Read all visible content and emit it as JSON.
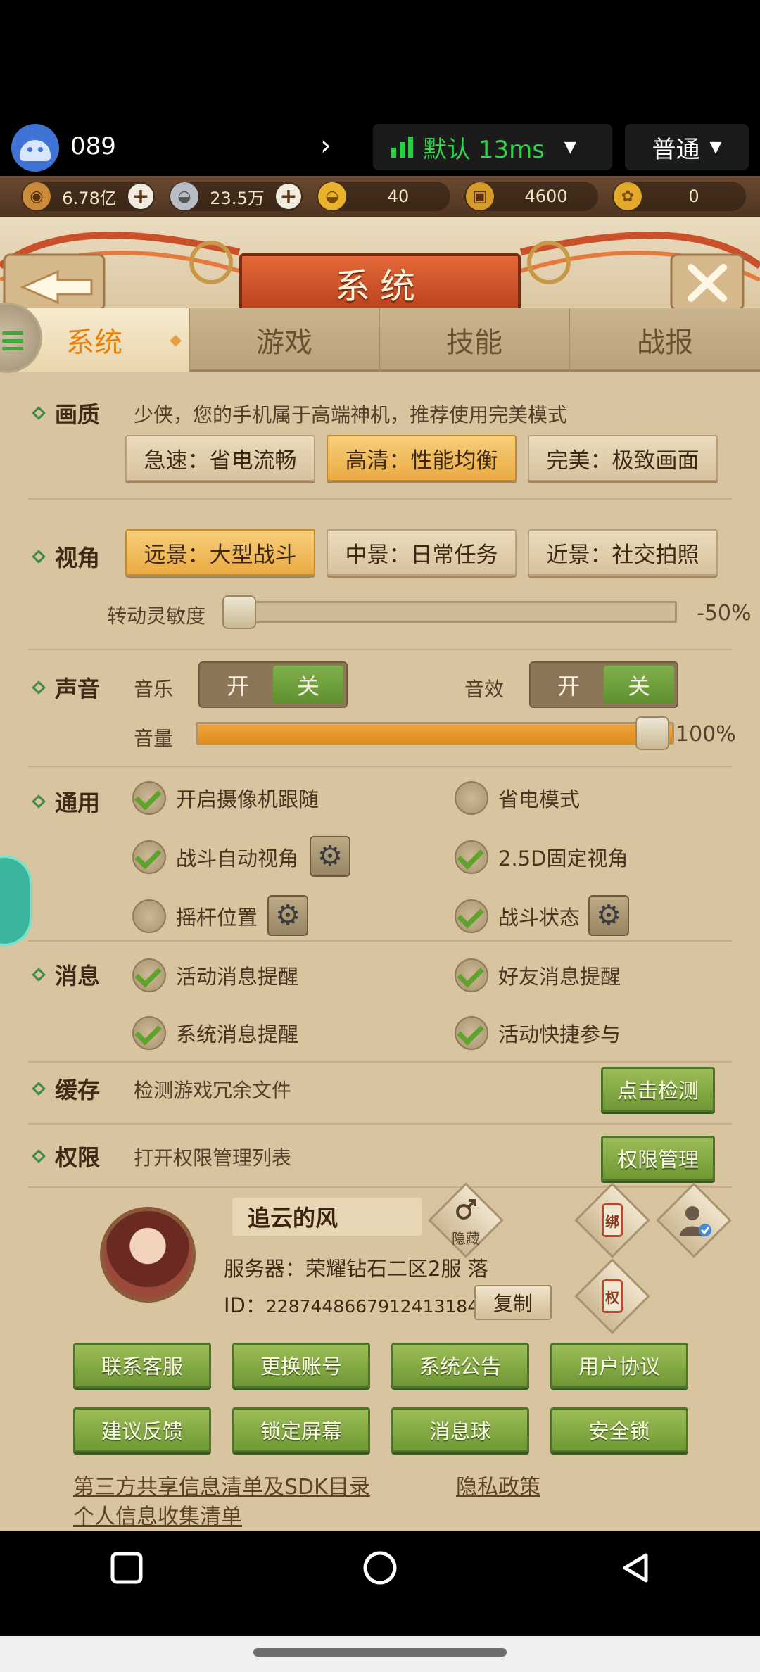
{
  "emulator": {
    "app_name": "089",
    "network": {
      "label": "默认 13ms",
      "color": "#34d14d"
    },
    "mode": {
      "label": "普通"
    }
  },
  "currency": [
    {
      "icon": "coin-icon",
      "value": "6.78亿",
      "has_plus": true
    },
    {
      "icon": "silver-ingot-icon",
      "value": "23.5万",
      "has_plus": true
    },
    {
      "icon": "gold-ingot-icon",
      "value": "40",
      "has_plus": false
    },
    {
      "icon": "gold-chest-icon",
      "value": "4600",
      "has_plus": false
    },
    {
      "icon": "gold-medal-icon",
      "value": "0",
      "has_plus": false
    }
  ],
  "window": {
    "title": "系统"
  },
  "tabs": [
    {
      "label": "系统",
      "active": true
    },
    {
      "label": "游戏",
      "active": false
    },
    {
      "label": "技能",
      "active": false
    },
    {
      "label": "战报",
      "active": false
    }
  ],
  "quality": {
    "label": "画质",
    "description": "少侠，您的手机属于高端神机，推荐使用完美模式",
    "options": [
      "急速：省电流畅",
      "高清：性能均衡",
      "完美：极致画面"
    ],
    "selected_index": 1
  },
  "view": {
    "label": "视角",
    "options": [
      "远景：大型战斗",
      "中景：日常任务",
      "近景：社交拍照"
    ],
    "selected_index": 0,
    "sensitivity_label": "转动灵敏度",
    "sensitivity_value": "-50%",
    "sensitivity_fraction": 0
  },
  "sound": {
    "label": "声音",
    "music_label": "音乐",
    "effects_label": "音效",
    "on_label": "开",
    "off_label": "关",
    "music_on": false,
    "effects_on": false,
    "volume_label": "音量",
    "volume_value": "100%",
    "volume_fraction": 1.0
  },
  "general": {
    "label": "通用",
    "items": [
      {
        "label": "开启摄像机跟随",
        "checked": true
      },
      {
        "label": "省电模式",
        "checked": false
      },
      {
        "label": "战斗自动视角",
        "checked": true,
        "gear": true
      },
      {
        "label": "2.5D固定视角",
        "checked": true
      },
      {
        "label": "摇杆位置",
        "checked": false,
        "gear": true
      },
      {
        "label": "战斗状态",
        "checked": true,
        "gear": true
      }
    ]
  },
  "messages": {
    "label": "消息",
    "items": [
      {
        "label": "活动消息提醒",
        "checked": true
      },
      {
        "label": "好友消息提醒",
        "checked": true
      },
      {
        "label": "系统消息提醒",
        "checked": true
      },
      {
        "label": "活动快捷参与",
        "checked": true
      }
    ]
  },
  "cache": {
    "label": "缓存",
    "description": "检测游戏冗余文件",
    "button": "点击检测"
  },
  "permission": {
    "label": "权限",
    "description": "打开权限管理列表",
    "button": "权限管理"
  },
  "profile": {
    "name": "追云的风",
    "hide_label": "隐藏",
    "server_label": "服务器：",
    "server": "荣耀钻石二区2服 落",
    "id_label": "ID：",
    "id": "2287448667912413184",
    "copy_button": "复制",
    "bind_label": "绑",
    "auth_label": "权"
  },
  "actions": [
    "联系客服",
    "更换账号",
    "系统公告",
    "用户协议",
    "建议反馈",
    "锁定屏幕",
    "消息球",
    "安全锁"
  ],
  "links": {
    "third_party": "第三方共享信息清单及SDK目录",
    "privacy": "隐私政策",
    "personal_info": "个人信息收集清单"
  },
  "colors": {
    "accent_orange": "#e8800c",
    "green_button": "#6f9834",
    "panel": "#d8c5a0"
  }
}
